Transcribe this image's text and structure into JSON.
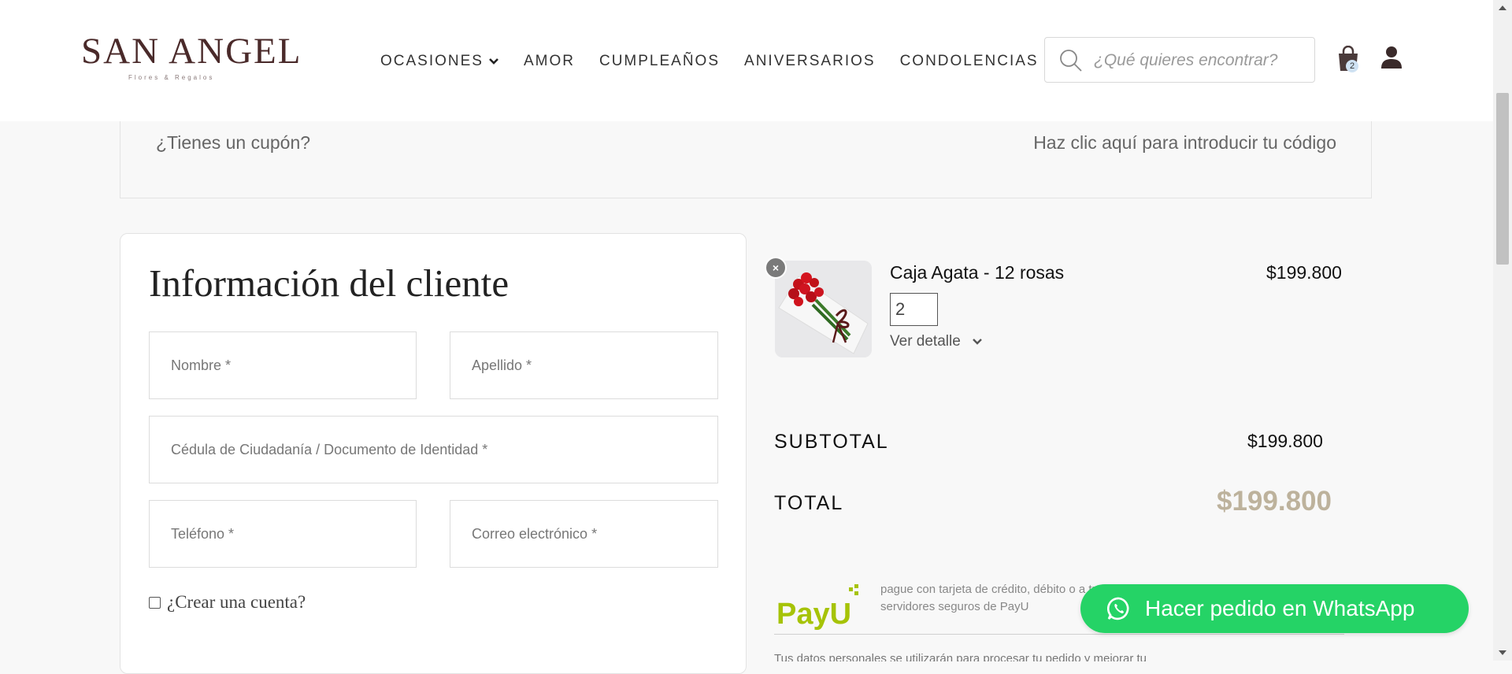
{
  "header": {
    "logo_main": "SAN ANGEL",
    "logo_sub": "Flores & Regalos",
    "nav": [
      {
        "label": "OCASIONES",
        "has_dropdown": true
      },
      {
        "label": "AMOR"
      },
      {
        "label": "CUMPLEAÑOS"
      },
      {
        "label": "ANIVERSARIOS"
      },
      {
        "label": "CONDOLENCIAS"
      }
    ],
    "search_placeholder": "¿Qué quieres encontrar?",
    "cart_count": "2",
    "icons": {
      "search": "search-icon",
      "cart": "shopping-bag-icon",
      "user": "user-icon"
    }
  },
  "coupon": {
    "question": "¿Tienes un cupón?",
    "link": "Haz clic aquí para introducir tu código"
  },
  "customer_form": {
    "title": "Información del cliente",
    "fields": {
      "first_name": "Nombre *",
      "last_name": "Apellido *",
      "id_document": "Cédula de Ciudadanía / Documento de Identidad *",
      "phone": "Teléfono *",
      "email": "Correo electrónico *"
    },
    "create_account": "¿Crear una cuenta?"
  },
  "order": {
    "product": {
      "name": "Caja Agata - 12 rosas",
      "price": "$199.800",
      "quantity": "2",
      "detail_label": "Ver detalle"
    },
    "subtotal_label": "SUBTOTAL",
    "subtotal_value": "$199.800",
    "total_label": "TOTAL",
    "total_value": "$199.800"
  },
  "payment": {
    "provider": "PayU",
    "description": "pague con tarjeta de crédito, débito o a través de los servidores seguros de PayU",
    "bottom_text": "Tus datos personales se utilizarán para procesar tu pedido y mejorar tu"
  },
  "whatsapp": {
    "label": "Hacer pedido en WhatsApp"
  },
  "colors": {
    "brand": "#4a2a2a",
    "total": "#bdb29c",
    "whatsapp": "#25d366",
    "payu": "#a6c307"
  }
}
